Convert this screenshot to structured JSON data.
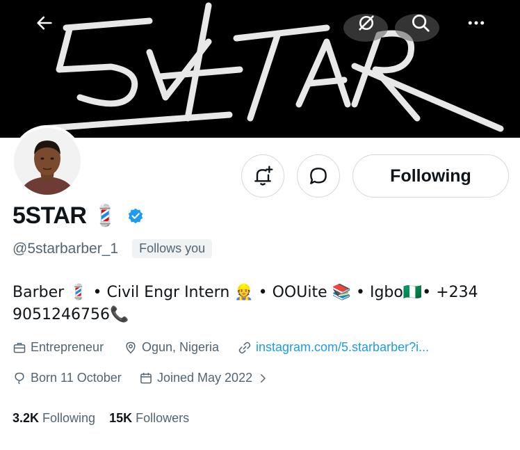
{
  "profile": {
    "display_name": "5STAR",
    "name_emoji": "💈",
    "handle": "@5starbarber_1",
    "follows_you": "Follows you",
    "bio_line1": "Barber 💈 • Civil Engr Intern 👷 • OOUite 📚 • Igbo🇳🇬• +234",
    "bio_line2": "9051246756📞",
    "occupation": "Entrepreneur",
    "location": "Ogun, Nigeria",
    "website": "instagram.com/5.starbarber?i...",
    "birthday": "Born 11 October",
    "joined": "Joined May 2022",
    "following_count": "3.2K",
    "following_label": "Following",
    "followers_count": "15K",
    "followers_label": "Followers"
  },
  "actions": {
    "following_button": "Following"
  },
  "banner": {
    "wordmark": "5STAR"
  },
  "icons": {
    "back": "arrow-left-icon",
    "grok": "grok-icon",
    "search": "search-icon",
    "more": "more-icon",
    "notify": "bell-plus-icon",
    "message": "message-icon",
    "verified": "verified-badge-icon",
    "briefcase": "briefcase-icon",
    "location": "location-pin-icon",
    "link": "link-icon",
    "balloon": "balloon-icon",
    "calendar": "calendar-icon",
    "chevron": "chevron-right-icon"
  },
  "colors": {
    "verified": "#1d9bf0",
    "link": "#1d9bf0",
    "secondary": "#536471"
  }
}
